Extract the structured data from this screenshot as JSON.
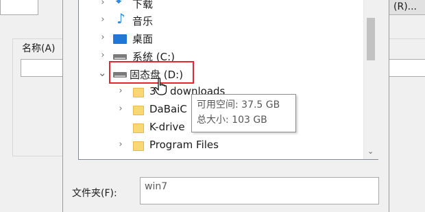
{
  "parent_dialog": {
    "name_label": "名称(A)",
    "right_button_label": "(R)..."
  },
  "tree": {
    "items": [
      {
        "label": "下载",
        "icon": "download-icon",
        "expanded": false
      },
      {
        "label": "音乐",
        "icon": "music-icon",
        "expanded": false
      },
      {
        "label": "桌面",
        "icon": "desktop-icon",
        "expanded": false
      },
      {
        "label": "系统 (C:)",
        "icon": "drive-icon",
        "expanded": false
      },
      {
        "label": "固态盘 (D:)",
        "icon": "drive-icon",
        "expanded": true,
        "highlighted": true
      },
      {
        "label": "3",
        "icon": "folder-icon",
        "child": true
      },
      {
        "label": "DaBaiC",
        "icon": "folder-icon",
        "child": true
      },
      {
        "label": "K-drive",
        "icon": "folder-icon",
        "child": true
      },
      {
        "label": "Program Files",
        "icon": "folder-icon",
        "child": true
      },
      {
        "label": "",
        "icon": "folder-icon",
        "child": true
      }
    ],
    "partial_behind_cursor": "downloads"
  },
  "tooltip": {
    "line1": "可用空间: 37.5 GB",
    "line2": "总大小: 103 GB"
  },
  "folder_field": {
    "label": "文件夹(F):",
    "value": "win7"
  },
  "colors": {
    "highlight": "#e3272c",
    "accent": "#2b8ae6",
    "folder": "#f8d775"
  }
}
